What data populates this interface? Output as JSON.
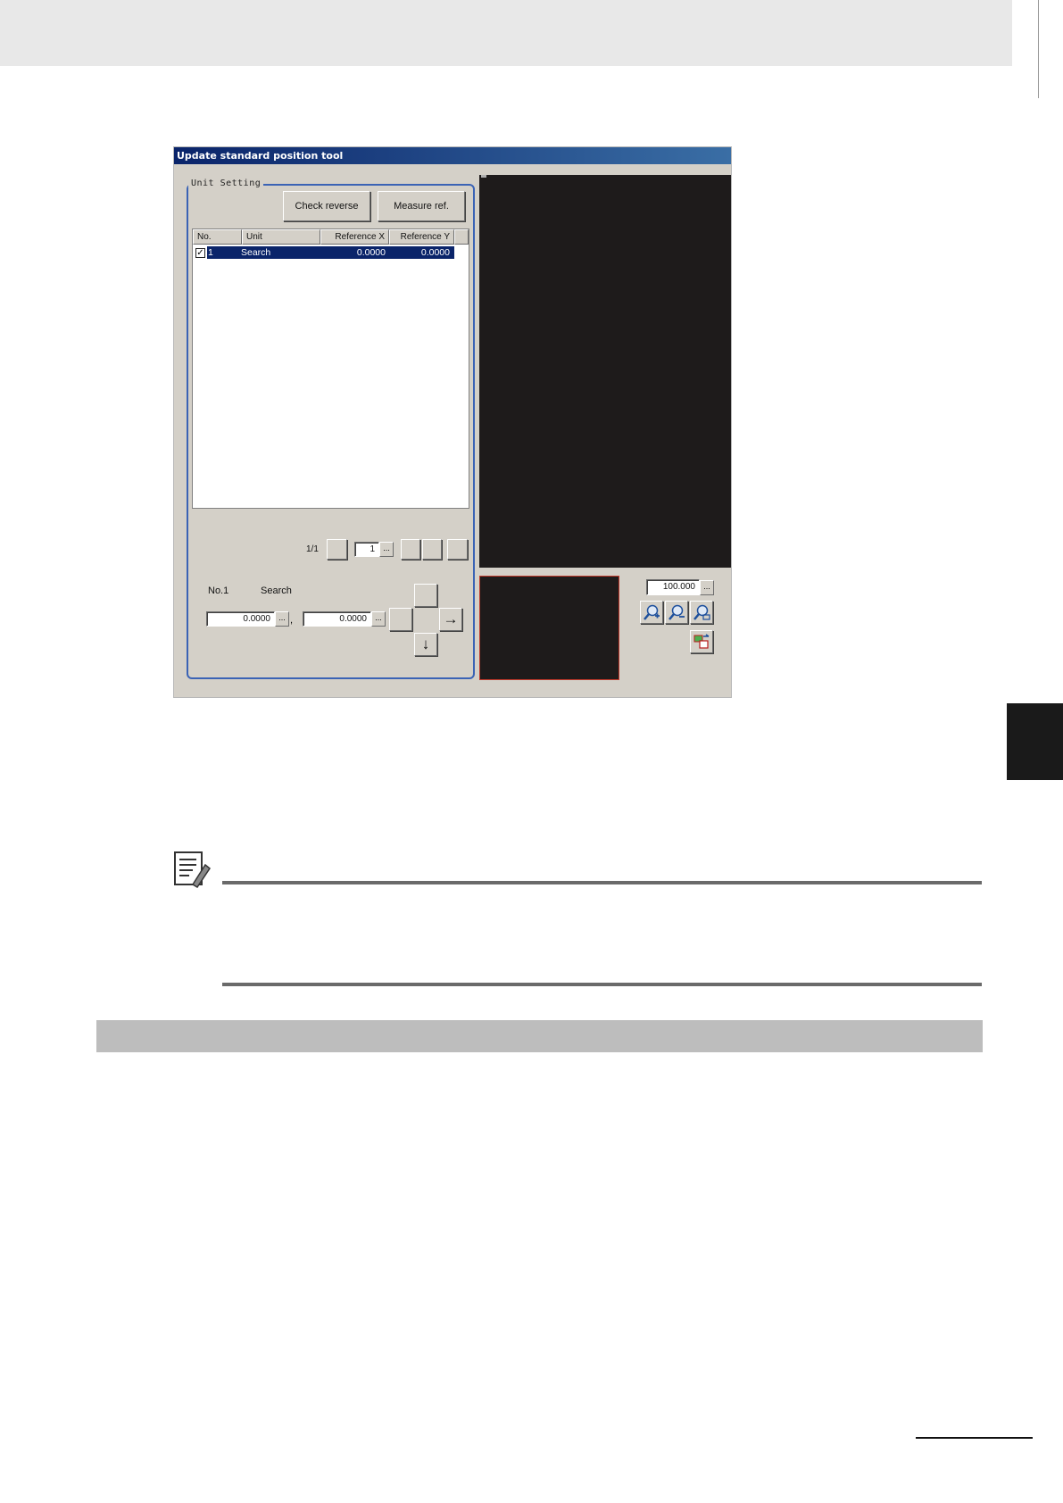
{
  "window": {
    "title": "Update standard position tool",
    "group_title": "Unit Setting",
    "buttons": {
      "check_reverse": "Check reverse",
      "measure_ref": "Measure ref."
    },
    "table": {
      "columns": [
        "No.",
        "Unit",
        "Reference X",
        "Reference Y"
      ],
      "rows": [
        {
          "checked": true,
          "no": "1",
          "unit": "Search",
          "ref_x": "0.0000",
          "ref_y": "0.0000"
        }
      ]
    },
    "pager": {
      "text": "1/1",
      "page_value": "1",
      "dots": "..."
    },
    "selected": {
      "no_label": "No.1",
      "unit_label": "Search",
      "x_value": "0.0000",
      "y_value": "0.0000",
      "separator": ","
    },
    "arrows": {
      "right": "→",
      "down": "↓"
    },
    "zoom": {
      "value": "100.000"
    },
    "colors": {
      "titlebar": "#0a246a",
      "group_border": "#3b63b5",
      "selection": "#0a246a",
      "thumbnail_border": "#c0392b",
      "image_bg": "#1e1b1b"
    },
    "icons": [
      "zoom-in-icon",
      "zoom-out-icon",
      "zoom-fit-icon",
      "image-swap-icon",
      "note-pencil-icon"
    ]
  }
}
